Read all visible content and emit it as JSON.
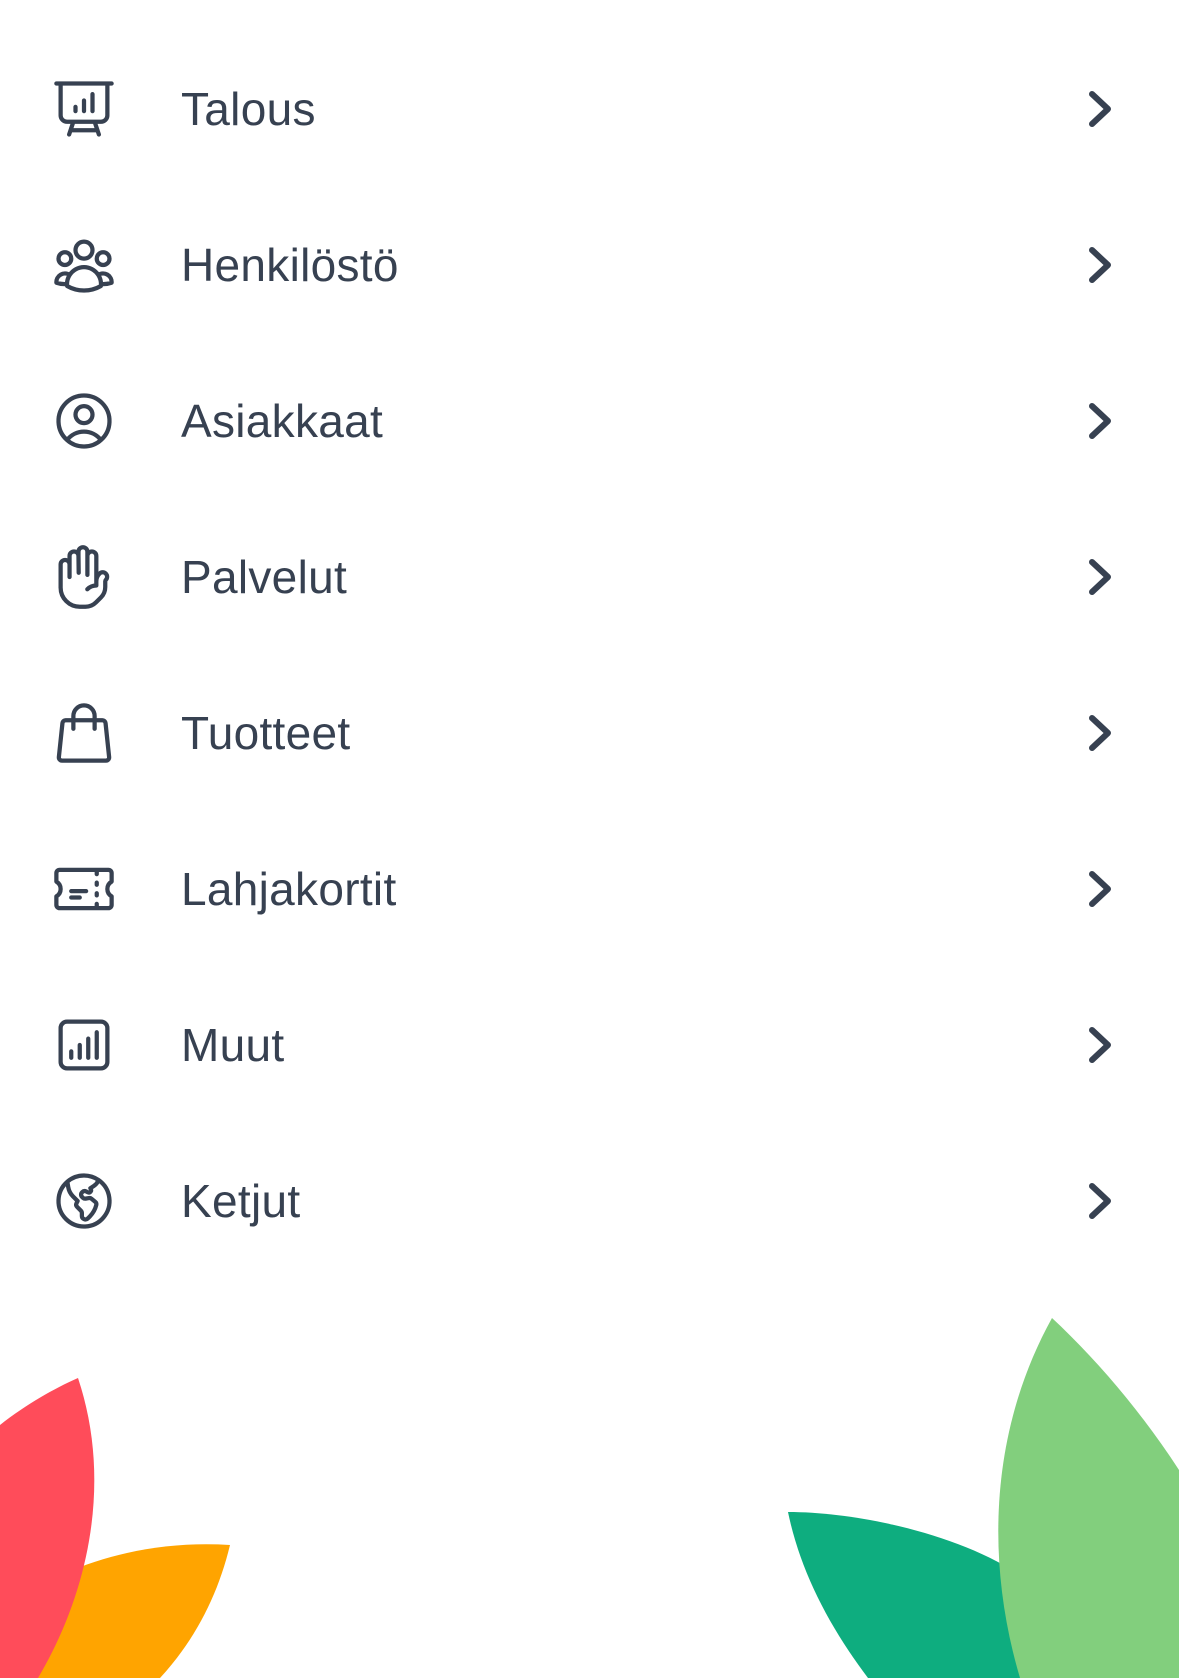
{
  "colors": {
    "text": "#374151",
    "icon": "#374151",
    "leaf_red": "#FF4C5A",
    "leaf_orange": "#FFA400",
    "leaf_dark_green": "#0EAD7F",
    "leaf_light_green": "#82CF7D"
  },
  "menu": {
    "items": [
      {
        "label": "Talous",
        "icon": "presentation-chart-icon"
      },
      {
        "label": "Henkilöstö",
        "icon": "user-group-icon"
      },
      {
        "label": "Asiakkaat",
        "icon": "user-circle-icon"
      },
      {
        "label": "Palvelut",
        "icon": "hand-raised-icon"
      },
      {
        "label": "Tuotteet",
        "icon": "shopping-bag-icon"
      },
      {
        "label": "Lahjakortit",
        "icon": "ticket-icon"
      },
      {
        "label": "Muut",
        "icon": "chart-bar-square-icon"
      },
      {
        "label": "Ketjut",
        "icon": "globe-icon"
      }
    ],
    "chevron_icon": "chevron-right-icon"
  }
}
